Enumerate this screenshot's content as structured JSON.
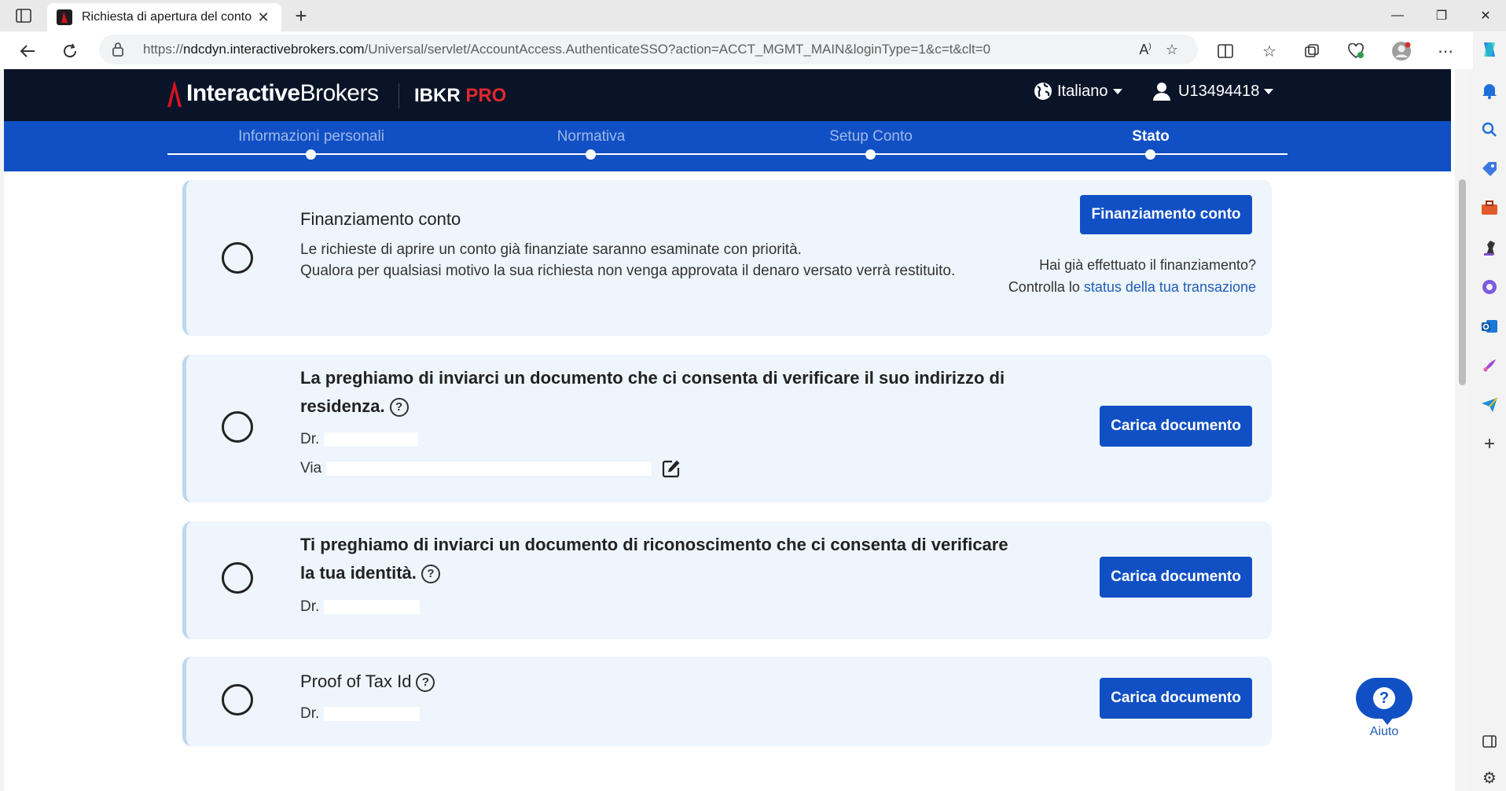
{
  "browser": {
    "tab_title": "Richiesta di apertura del conto",
    "url_prefix": "https://",
    "url_host": "ndcdyn.interactivebrokers.com",
    "url_path": "/Universal/servlet/AccountAccess.AuthenticateSSO?action=ACCT_MGMT_MAIN&loginType=1&c=t&clt=0"
  },
  "header": {
    "logo_bold": "Interactive",
    "logo_light": "Brokers",
    "product": "IBKR",
    "product_accent": "PRO",
    "language": "Italiano",
    "account_id": "U13494418"
  },
  "steps": [
    {
      "label": "Informazioni personali"
    },
    {
      "label": "Normativa"
    },
    {
      "label": "Setup Conto"
    },
    {
      "label": "Stato"
    }
  ],
  "cards": {
    "funding": {
      "title": "Finanziamento conto",
      "line1": "Le richieste di aprire un conto già finanziate saranno esaminate con priorità.",
      "line2": "Qualora per qualsiasi motivo la sua richiesta non venga approvata il denaro versato verrà restituito.",
      "button": "Finanziamento conto",
      "note_q": "Hai già effettuato il finanziamento?",
      "note_prefix": "Controlla lo ",
      "note_link": "status della tua transazione"
    },
    "address": {
      "title_line1": "La preghiamo di inviarci un documento che ci consenta di verificare il suo indirizzo di",
      "title_line2": "residenza.",
      "name_prefix": "Dr.",
      "address_prefix": "Via",
      "button": "Carica documento"
    },
    "identity": {
      "title_line1": "Ti preghiamo di inviarci un documento di riconoscimento che ci consenta di verificare",
      "title_line2": "la tua identità.",
      "name_prefix": "Dr.",
      "button": "Carica documento"
    },
    "tax": {
      "title": "Proof of Tax Id",
      "name_prefix": "Dr.",
      "button": "Carica documento"
    }
  },
  "help": {
    "question_mark": "?",
    "label": "Aiuto"
  },
  "colors": {
    "brand_dark": "#0a1428",
    "brand_blue": "#1150c4",
    "accent_red": "#e0272f"
  }
}
